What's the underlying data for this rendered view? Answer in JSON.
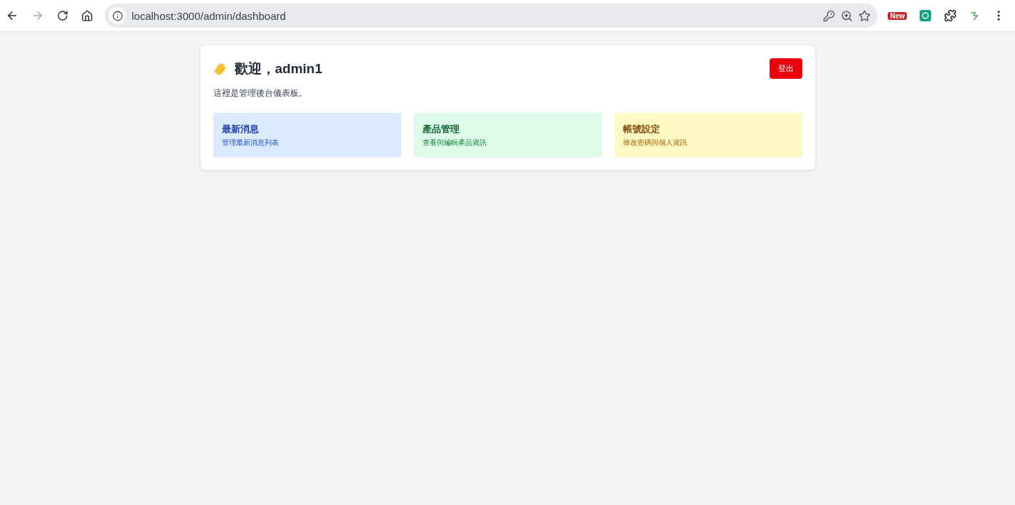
{
  "browser": {
    "url": "localhost:3000/admin/dashboard",
    "extension_badge": "New"
  },
  "header": {
    "title": "歡迎，admin1",
    "subtitle": "這裡是管理後台儀表板。",
    "logout": "登出"
  },
  "cards": [
    {
      "title": "最新消息",
      "description": "管理最新消息列表",
      "color": "#dbeafe"
    },
    {
      "title": "產品管理",
      "description": "查看與編輯產品資訊",
      "color": "#dcfce7"
    },
    {
      "title": "帳號設定",
      "description": "修改密碼與個人資訊",
      "color": "#fef9c3"
    }
  ]
}
